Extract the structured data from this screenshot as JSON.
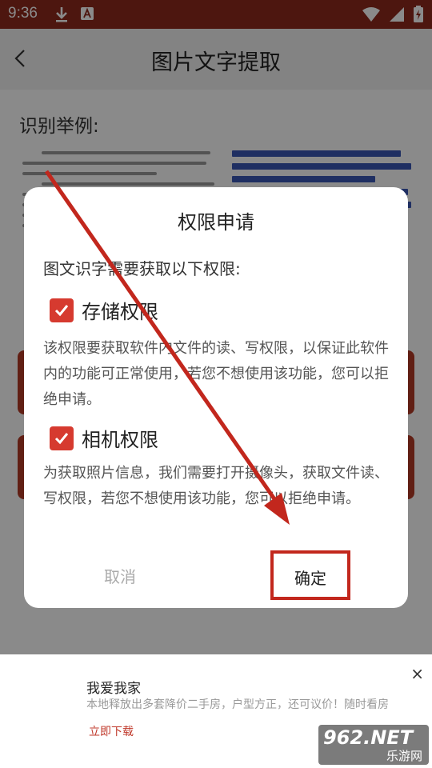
{
  "status_bar": {
    "time": "9:36"
  },
  "app_bar": {
    "title": "图片文字提取"
  },
  "content": {
    "example_label": "识别举例:"
  },
  "dialog": {
    "title": "权限申请",
    "intro": "图文识字需要获取以下权限:",
    "permissions": [
      {
        "name": "存储权限",
        "checked": true,
        "description": "该权限要获取软件内文件的读、写权限，以保证此软件内的功能可正常使用，若您不想使用该功能，您可以拒绝申请。"
      },
      {
        "name": "相机权限",
        "checked": true,
        "description": "为获取照片信息，我们需要打开摄像头，获取文件读、写权限，若您不想使用该功能，您可以拒绝申请。"
      }
    ],
    "cancel_label": "取消",
    "ok_label": "确定"
  },
  "ad": {
    "title": "我爱我家",
    "description": "本地释放出多套降价二手房，户型方正，还可议价！随时看房",
    "cta": "立即下载",
    "close": "×"
  },
  "watermark": {
    "logo": "962.NET",
    "sub": "乐游网"
  },
  "colors": {
    "status_bar": "#8e2a1d",
    "accent_red": "#c2271d",
    "checkbox": "#d63a2f"
  }
}
